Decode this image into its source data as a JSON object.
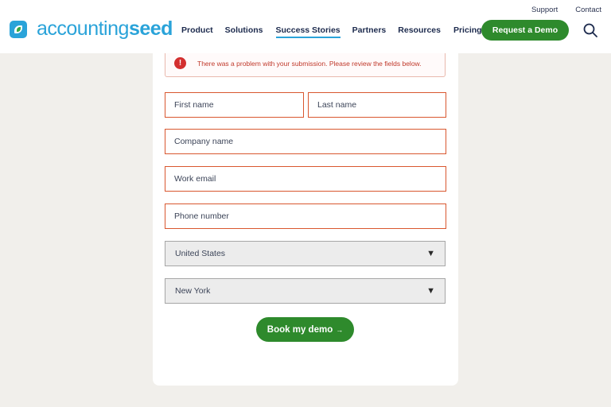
{
  "header": {
    "logo_part1": "accounting",
    "logo_part2": "seed",
    "utility": {
      "support": "Support",
      "contact": "Contact"
    },
    "nav": [
      "Product",
      "Solutions",
      "Success Stories",
      "Partners",
      "Resources",
      "Pricing"
    ],
    "active_nav": "Success Stories",
    "cta_label": "Request a Demo",
    "search_icon": "search-icon"
  },
  "form": {
    "error_icon": "!",
    "error_message": "There was a problem with your submission. Please review the fields below.",
    "first_name_placeholder": "First name",
    "last_name_placeholder": "Last name",
    "company_placeholder": "Company name",
    "email_placeholder": "Work email",
    "phone_placeholder": "Phone number",
    "country_value": "United States",
    "state_value": "New York",
    "submit_label": "Book my demo",
    "submit_arrow": "→"
  },
  "colors": {
    "brand_blue": "#2aa3d9",
    "brand_green": "#2e8a2c",
    "error_red": "#d9572f",
    "page_bg": "#f1efeb"
  }
}
